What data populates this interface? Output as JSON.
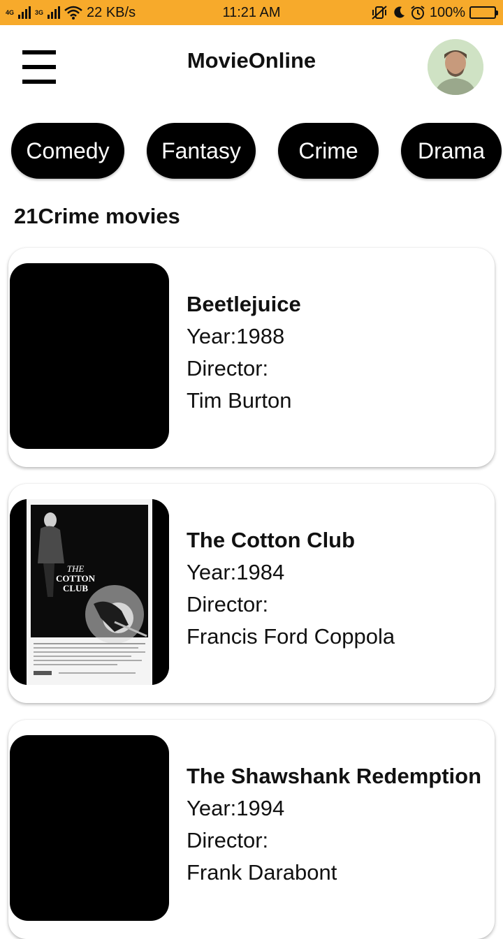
{
  "status_bar": {
    "net1": "4G",
    "net2": "3G",
    "speed": "22 KB/s",
    "time": "11:21 AM",
    "battery": "100%"
  },
  "app_bar": {
    "title": "MovieOnline"
  },
  "genres": [
    "Comedy",
    "Fantasy",
    "Crime",
    "Drama"
  ],
  "count_label": "21Crime movies",
  "movies": [
    {
      "title": "Beetlejuice",
      "year": "Year:1988",
      "director_label": "Director:",
      "director": "Tim Burton"
    },
    {
      "title": "The Cotton Club",
      "year": "Year:1984",
      "director_label": "Director:",
      "director": "Francis Ford Coppola",
      "poster_title": "THE COTTON CLUB"
    },
    {
      "title": "The Shawshank Redemption",
      "year": "Year:1994",
      "director_label": "Director:",
      "director": "Frank Darabont"
    }
  ]
}
